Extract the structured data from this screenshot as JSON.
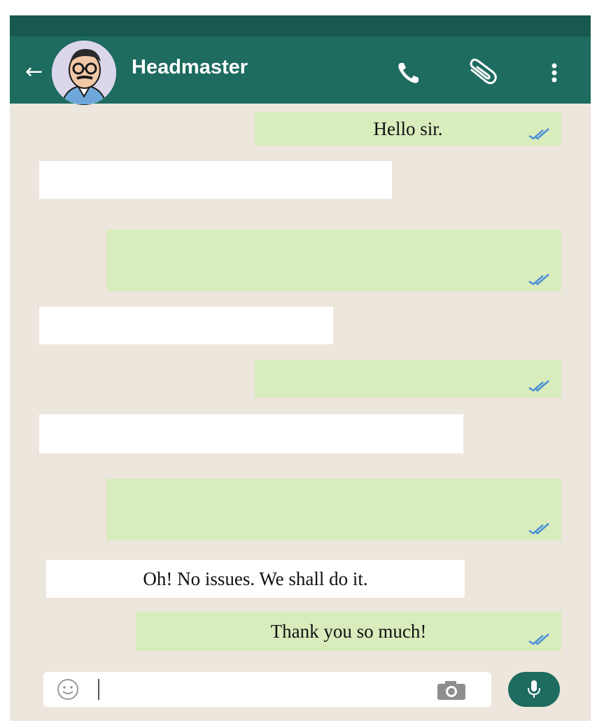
{
  "header": {
    "contact_name": "Headmaster",
    "back_icon": "arrow-left-icon",
    "call_icon": "phone-icon",
    "attach_icon": "paperclip-icon",
    "menu_icon": "more-vert-icon"
  },
  "messages": [
    {
      "dir": "out",
      "text": "Hello sir."
    },
    {
      "dir": "in",
      "text": ""
    },
    {
      "dir": "out",
      "text": ""
    },
    {
      "dir": "in",
      "text": ""
    },
    {
      "dir": "out",
      "text": ""
    },
    {
      "dir": "in",
      "text": ""
    },
    {
      "dir": "out",
      "text": ""
    },
    {
      "dir": "in",
      "text": "Oh! No issues. We shall do it."
    },
    {
      "dir": "out",
      "text": "Thank you so much!"
    }
  ],
  "composer": {
    "emoji_icon": "emoji-icon",
    "camera_icon": "camera-icon",
    "mic_icon": "microphone-icon",
    "text": ""
  },
  "colors": {
    "header": "#1e6b5f",
    "background": "#ece6dc",
    "outgoing": "#d8ecbc",
    "incoming": "#ffffff",
    "tick": "#4a8fd6"
  }
}
